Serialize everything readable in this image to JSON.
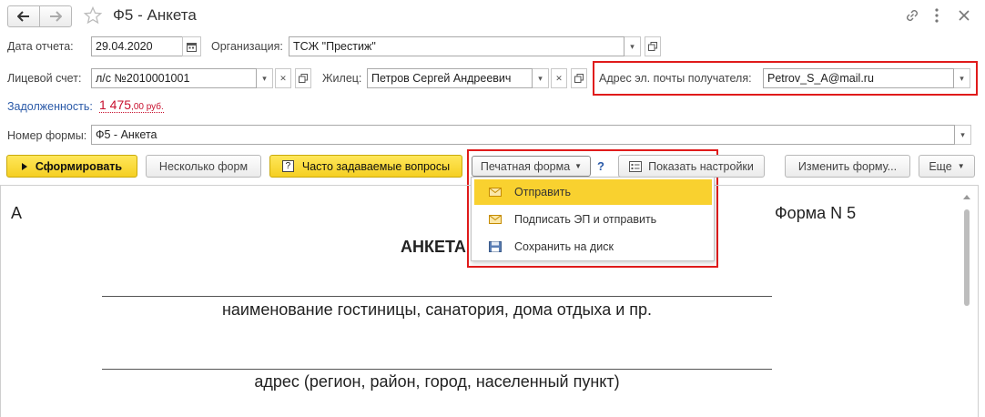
{
  "window": {
    "title": "Ф5 - Анкета"
  },
  "form": {
    "report_date_label": "Дата отчета:",
    "report_date_value": "29.04.2020",
    "organization_label": "Организация:",
    "organization_value": "ТСЖ \"Престиж\"",
    "account_label": "Лицевой счет:",
    "account_value": "л/с №2010001001",
    "resident_label": "Жилец:",
    "resident_value": "Петров Сергей Андреевич",
    "email_label": "Адрес эл. почты получателя:",
    "email_value": "Petrov_S_A@mail.ru",
    "debt_label": "Задолженность:",
    "debt_main": "1 475",
    "debt_fraction": ",00 руб.",
    "form_number_label": "Номер формы:",
    "form_number_value": "Ф5 - Анкета"
  },
  "toolbar": {
    "generate": "Сформировать",
    "several_forms": "Несколько форм",
    "faq": "Часто задаваемые вопросы",
    "print_form": "Печатная форма",
    "help": "?",
    "show_settings": "Показать настройки",
    "change_form": "Изменить форму...",
    "more": "Еще"
  },
  "print_menu": {
    "items": [
      {
        "label": "Отправить",
        "icon": "envelope-icon",
        "highlighted": true
      },
      {
        "label": "Подписать ЭП и отправить",
        "icon": "envelope-icon",
        "highlighted": false
      },
      {
        "label": "Сохранить на диск",
        "icon": "floppy-disk-icon",
        "highlighted": false
      }
    ]
  },
  "document": {
    "left_mark": "А",
    "form_label": "Форма N 5",
    "title": "АНКЕТА",
    "caption_hotel": "наименование гостиницы, санатория, дома отдыха и пр.",
    "caption_address": "адрес (регион, район, город, населенный пункт)"
  },
  "colors": {
    "accent_yellow": "#f5cf22",
    "highlight_red": "#e01b1b",
    "link_blue": "#2b5aa8",
    "debt_red": "#c8102e"
  }
}
